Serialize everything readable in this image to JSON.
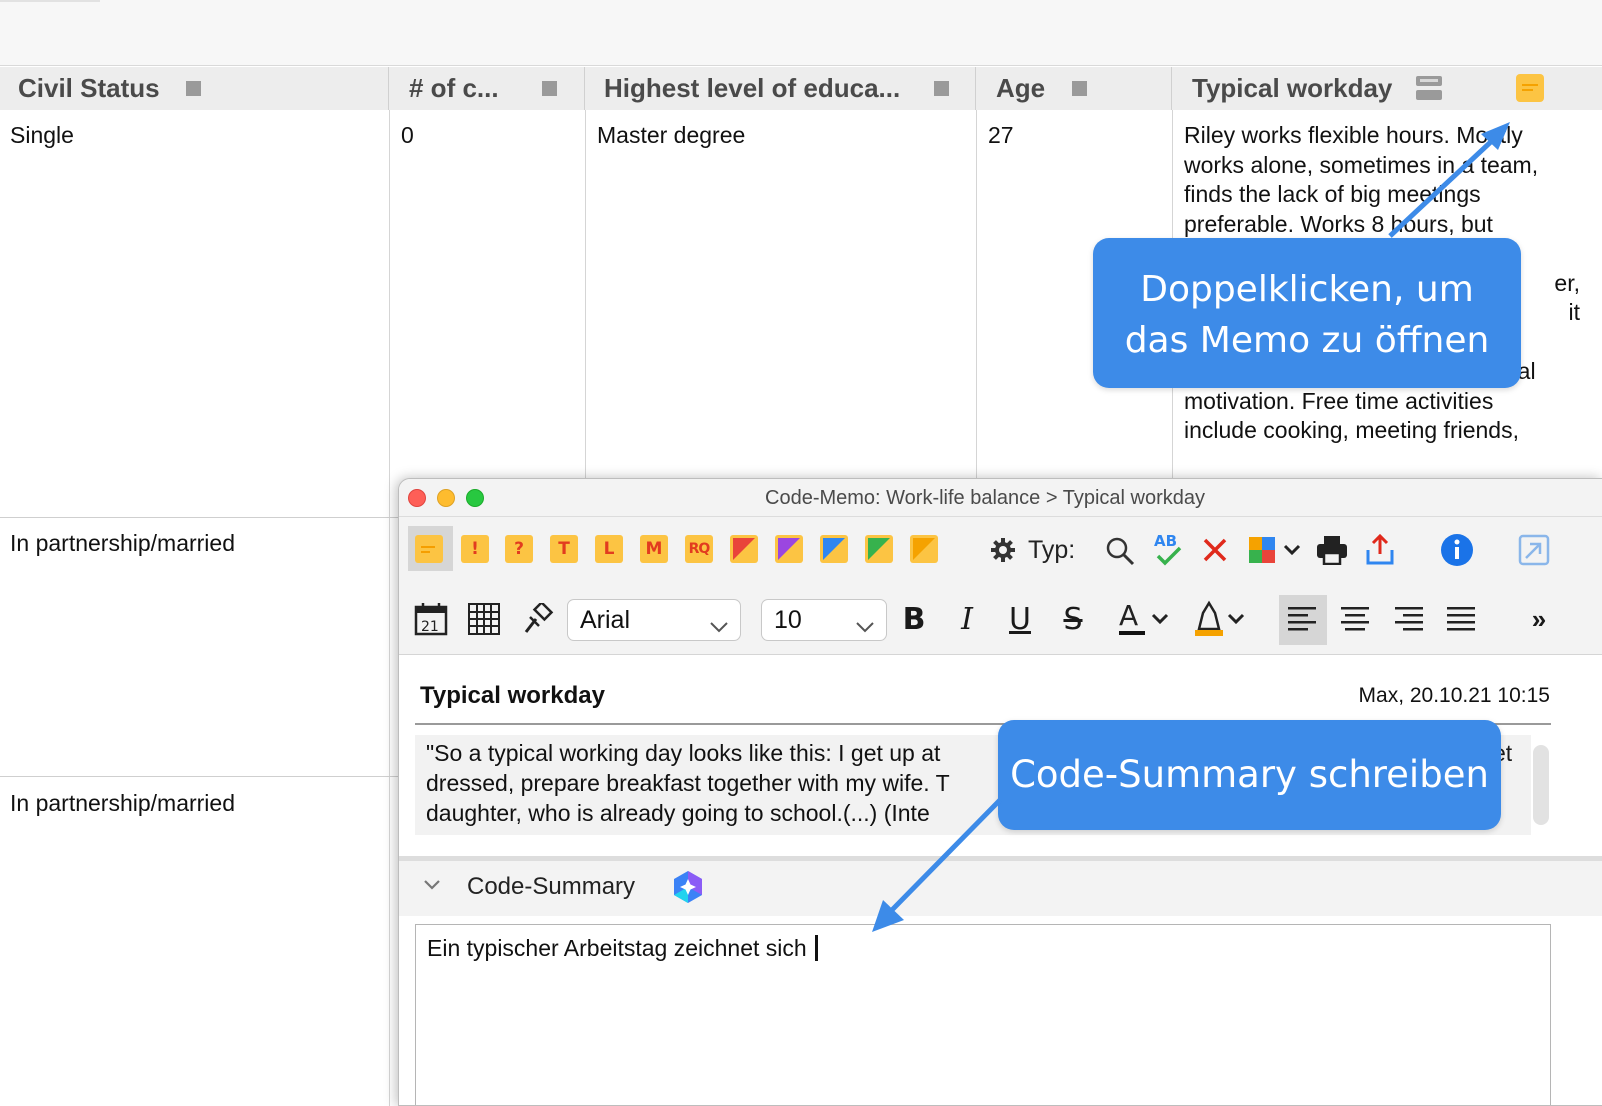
{
  "table": {
    "headers": [
      "Civil Status",
      "# of c...",
      "Highest level of educa...",
      "Age",
      "Typical workday"
    ],
    "rows": [
      {
        "civil_status": "Single",
        "children": "0",
        "education": "Master degree",
        "age": "27",
        "workday_lines": [
          "Riley works flexible hours. Mostly",
          "works alone, sometimes in a team,",
          "finds the lack of big meetings",
          "preferable. Works 8 hours, but",
          "",
          "er,",
          "it",
          "",
          "stresses the importance of internal",
          "motivation. Free time activities",
          "include cooking, meeting friends,"
        ]
      },
      {
        "civil_status": "In partnership/married"
      },
      {
        "civil_status": "In partnership/married"
      }
    ]
  },
  "callouts": {
    "memo_hint_line1": "Doppelklicken, um",
    "memo_hint_line2": "das Memo zu öffnen",
    "summary_hint": "Code-Summary schreiben"
  },
  "memo_window": {
    "title": "Code-Memo: Work-life balance > Typical workday",
    "memo_type_icons": [
      "memo-lines",
      "!",
      "?",
      "T",
      "L",
      "M",
      "RQ",
      "red",
      "purple",
      "blue",
      "green",
      "orange"
    ],
    "type_label": "Typ:",
    "font": "Arial",
    "font_size": "10",
    "overflow": "»",
    "memo_title": "Typical workday",
    "memo_meta": "Max, 20.10.21 10:15",
    "quote_lines": [
      "\"So a typical working day looks like this: I get up at",
      "dressed, prepare breakfast together with my wife. T",
      "daughter, who is already going to school.(...) (Inte"
    ],
    "quote_tail": "et",
    "summary_label": "Code-Summary",
    "summary_text": "Ein typischer Arbeitstag zeichnet sich"
  },
  "colors": {
    "accent_blue": "#3d8be8",
    "memo_yellow": "#fcc443",
    "icon_red": "#e23c1f",
    "info_blue": "#1a73e8"
  }
}
